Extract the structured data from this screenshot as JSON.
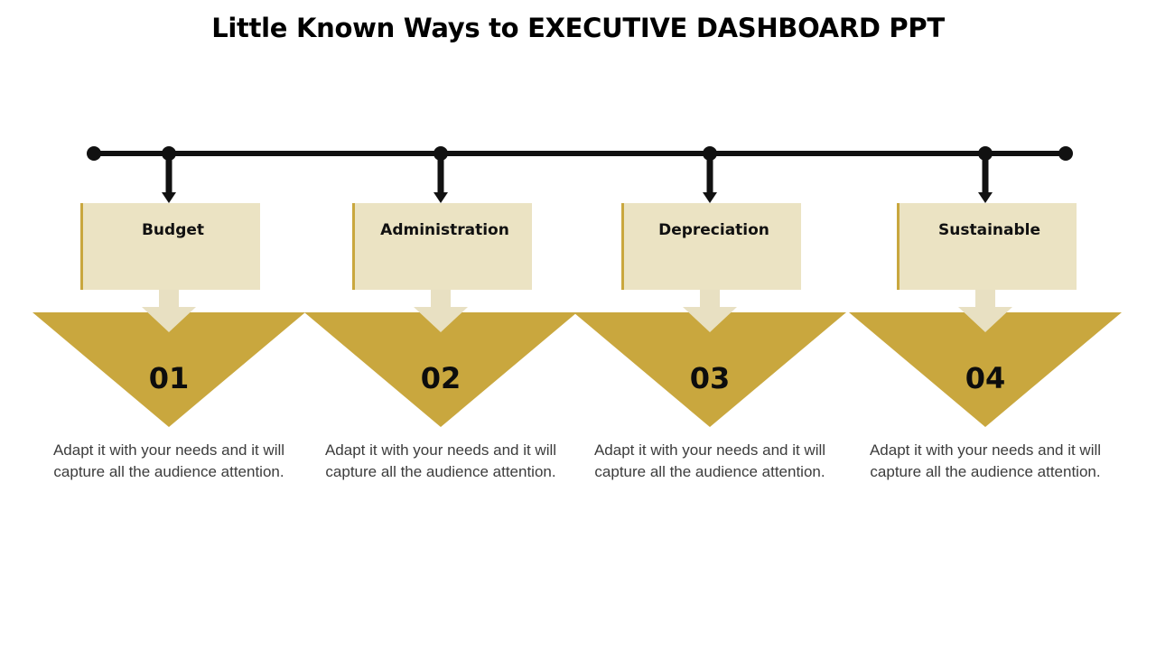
{
  "slide": {
    "title": "Little Known Ways to EXECUTIVE DASHBOARD PPT",
    "background_color": "#FFFFFF"
  },
  "theme": {
    "accent_gold": "#C9A73E",
    "card_cream": "#EBE3C3",
    "inner_arrow_cream": "#E8E0C2",
    "line_color": "#111111",
    "title_color": "#000000",
    "number_color": "#0D0D0D",
    "description_color": "#3C3C3C"
  },
  "timeline": {
    "start_dot": "timeline-start-dot",
    "end_dot": "timeline-end-dot",
    "node_count": 4
  },
  "steps": [
    {
      "number": "01",
      "label": "Budget",
      "description": "Adapt it with your needs and it will capture all the audience attention."
    },
    {
      "number": "02",
      "label": "Administration",
      "description": "Adapt it with your needs and it will capture all the audience attention."
    },
    {
      "number": "03",
      "label": "Depreciation",
      "description": "Adapt it with your needs and it will capture all the audience attention."
    },
    {
      "number": "04",
      "label": "Sustainable",
      "description": "Adapt it with your needs and it will capture all the audience attention."
    }
  ]
}
